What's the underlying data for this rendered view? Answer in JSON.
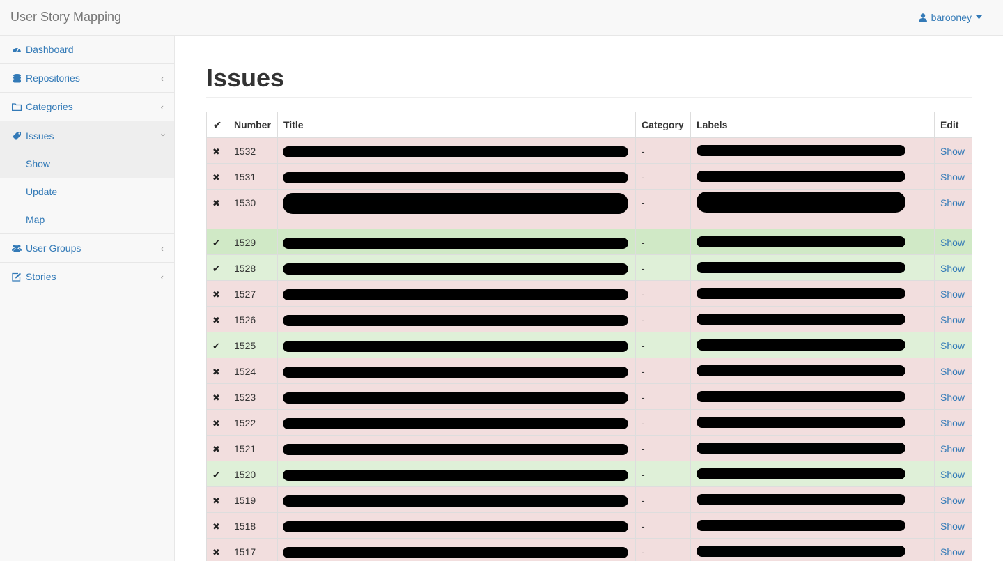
{
  "app": {
    "brand": "User Story Mapping",
    "user": "barooney"
  },
  "sidebar": {
    "items": [
      {
        "label": "Dashboard",
        "icon": "dashboard-icon"
      },
      {
        "label": "Repositories",
        "icon": "database-icon"
      },
      {
        "label": "Categories",
        "icon": "folder-icon"
      },
      {
        "label": "Issues",
        "icon": "ticket-icon",
        "sub": [
          "Show",
          "Update",
          "Map"
        ]
      },
      {
        "label": "User Groups",
        "icon": "users-icon"
      },
      {
        "label": "Stories",
        "icon": "edit-icon"
      }
    ]
  },
  "main": {
    "title": "Issues",
    "table": {
      "headers": {
        "status": "✔",
        "number": "Number",
        "title": "Title",
        "category": "Category",
        "labels": "Labels",
        "edit": "Edit"
      },
      "rows": [
        {
          "status": "closed",
          "number": "1532",
          "category": "-",
          "edit": "Show"
        },
        {
          "status": "closed",
          "number": "1531",
          "category": "-",
          "edit": "Show"
        },
        {
          "status": "closed",
          "number": "1530",
          "category": "-",
          "edit": "Show"
        },
        {
          "status": "done",
          "number": "1529",
          "category": "-",
          "edit": "Show"
        },
        {
          "status": "done",
          "number": "1528",
          "category": "-",
          "edit": "Show"
        },
        {
          "status": "closed",
          "number": "1527",
          "category": "-",
          "edit": "Show"
        },
        {
          "status": "closed",
          "number": "1526",
          "category": "-",
          "edit": "Show"
        },
        {
          "status": "done",
          "number": "1525",
          "category": "-",
          "edit": "Show"
        },
        {
          "status": "closed",
          "number": "1524",
          "category": "-",
          "edit": "Show"
        },
        {
          "status": "closed",
          "number": "1523",
          "category": "-",
          "edit": "Show"
        },
        {
          "status": "closed",
          "number": "1522",
          "category": "-",
          "edit": "Show"
        },
        {
          "status": "closed",
          "number": "1521",
          "category": "-",
          "edit": "Show"
        },
        {
          "status": "done",
          "number": "1520",
          "category": "-",
          "edit": "Show"
        },
        {
          "status": "closed",
          "number": "1519",
          "category": "-",
          "edit": "Show"
        },
        {
          "status": "closed",
          "number": "1518",
          "category": "-",
          "edit": "Show"
        },
        {
          "status": "closed",
          "number": "1517",
          "category": "-",
          "edit": "Show"
        }
      ]
    }
  },
  "colors": {
    "link": "#337ab7",
    "danger_row": "#f2dede",
    "success_row": "#dff0d8"
  },
  "icons": {
    "check": "check-icon",
    "cross": "times-icon",
    "user": "user-icon",
    "caret": "caret-down-icon",
    "chevron": "chevron-left-icon"
  }
}
